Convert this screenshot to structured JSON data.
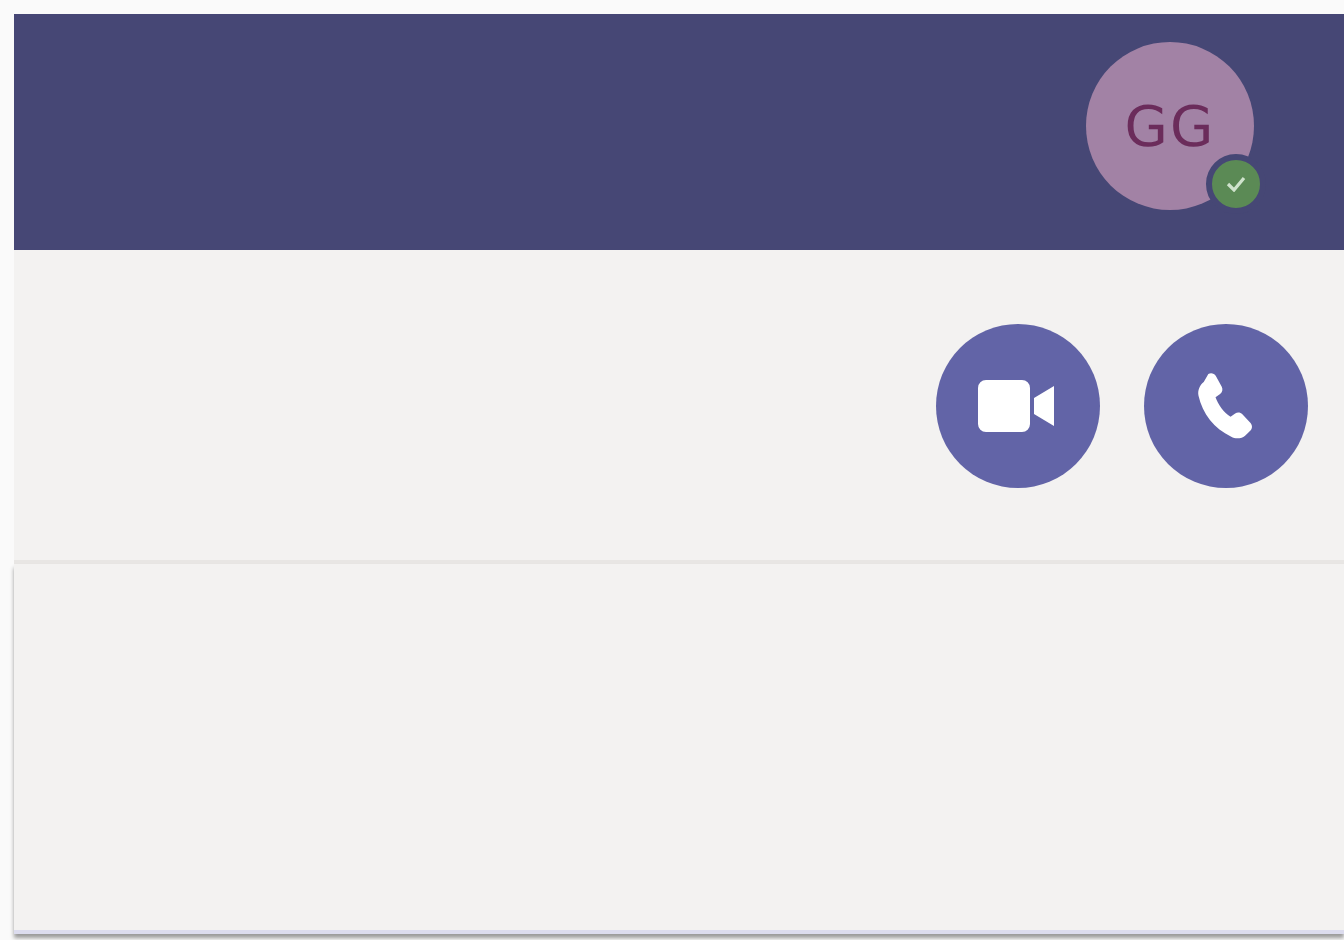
{
  "header": {
    "avatar": {
      "initials": "GG",
      "available": true
    }
  },
  "call_buttons": [
    {
      "kind": "video"
    },
    {
      "kind": "audio"
    }
  ]
}
